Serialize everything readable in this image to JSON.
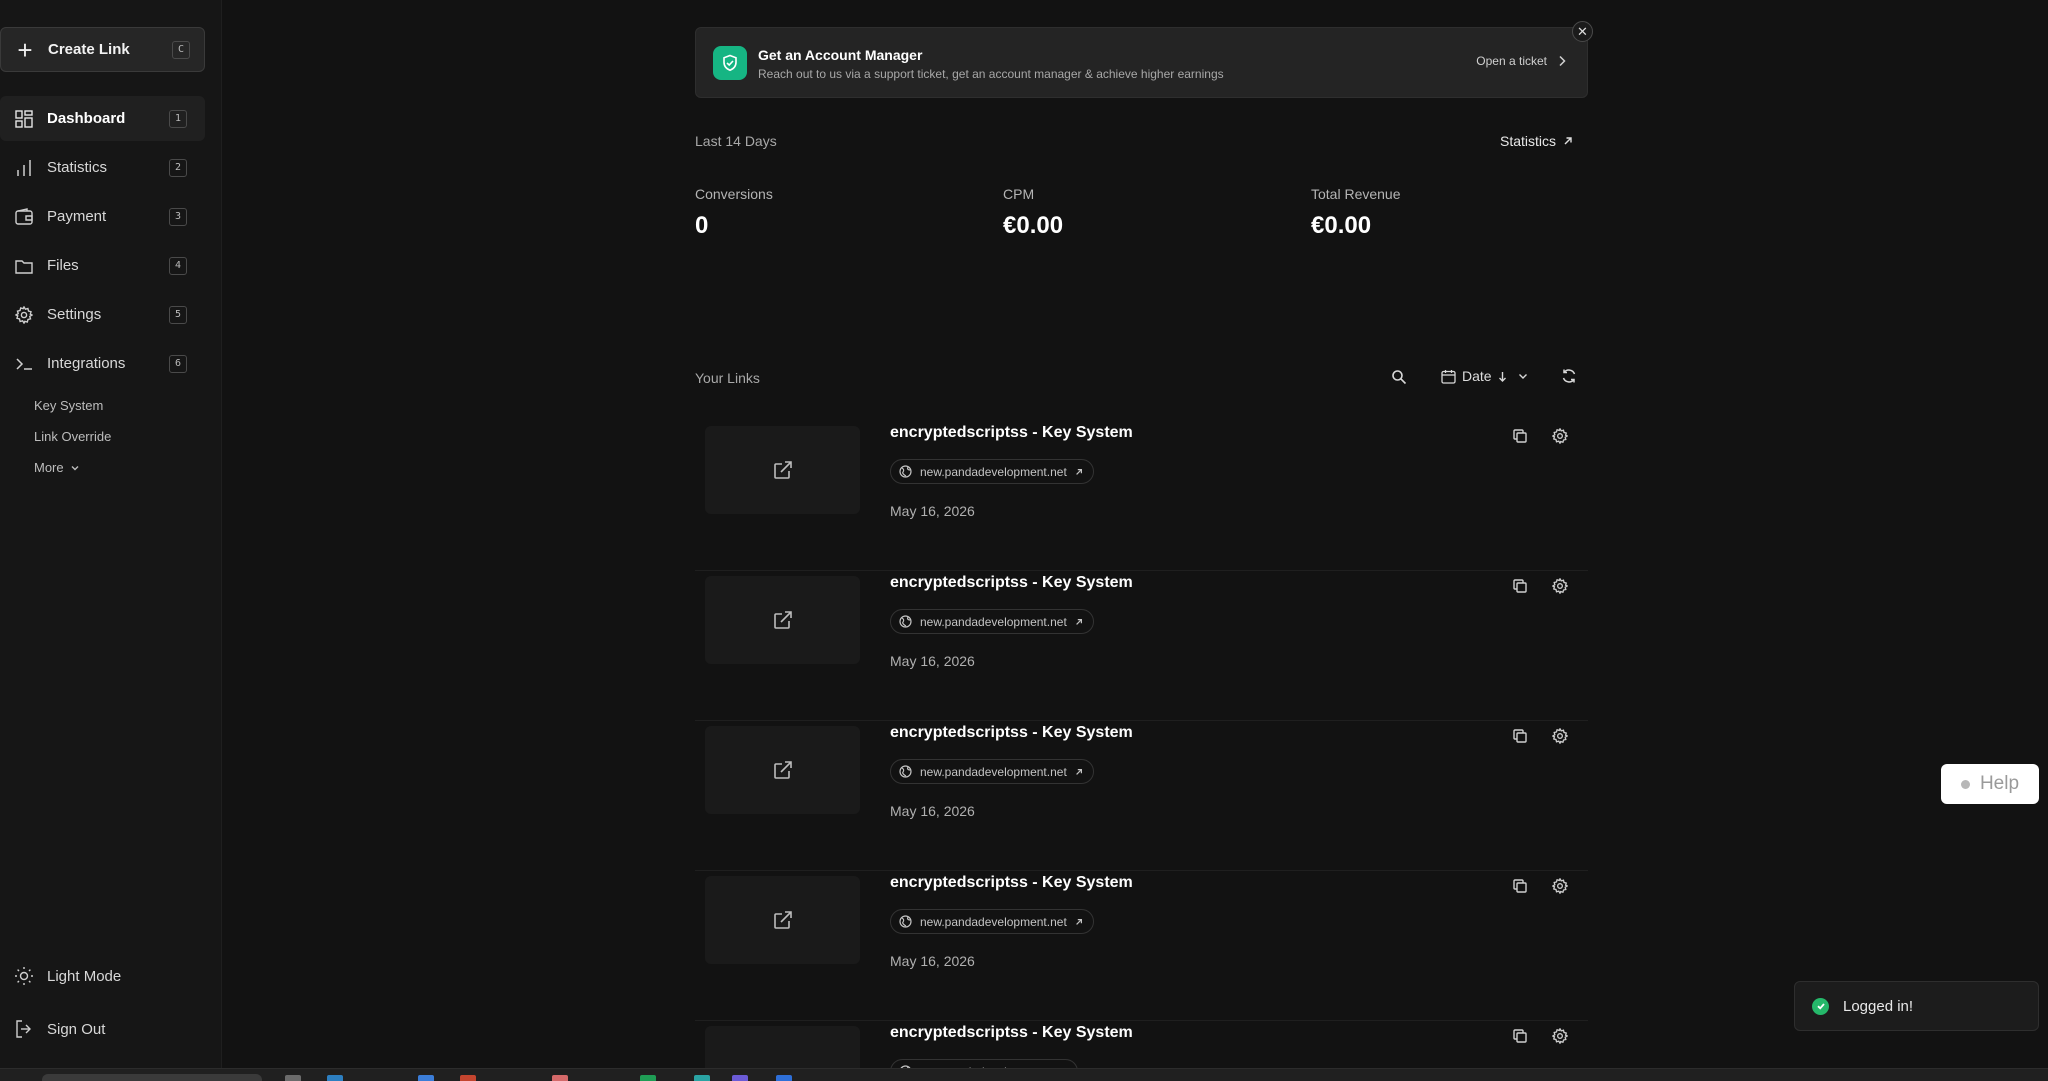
{
  "sidebar": {
    "create": {
      "label": "Create Link",
      "shortcut": "C"
    },
    "nav": [
      {
        "label": "Dashboard",
        "key": "1",
        "icon": "dashboard-icon",
        "active": true
      },
      {
        "label": "Statistics",
        "key": "2",
        "icon": "bar-chart-icon"
      },
      {
        "label": "Payment",
        "key": "3",
        "icon": "wallet-icon"
      },
      {
        "label": "Files",
        "key": "4",
        "icon": "folder-icon"
      },
      {
        "label": "Settings",
        "key": "5",
        "icon": "gear-icon"
      },
      {
        "label": "Integrations",
        "key": "6",
        "icon": "terminal-icon"
      }
    ],
    "sub_items": [
      "Key System",
      "Link Override"
    ],
    "more_label": "More",
    "light_mode": "Light Mode",
    "sign_out": "Sign Out"
  },
  "banner": {
    "title": "Get an Account Manager",
    "description": "Reach out to us via a support ticket, get an account manager & achieve higher earnings",
    "cta": "Open a ticket",
    "accent": "#16b583"
  },
  "overview": {
    "period": "Last 14 Days",
    "statistics_link": "Statistics",
    "metrics": [
      {
        "label": "Conversions",
        "value": "0"
      },
      {
        "label": "CPM",
        "value": "€0.00"
      },
      {
        "label": "Total Revenue",
        "value": "€0.00"
      }
    ]
  },
  "links_section": {
    "title": "Your Links",
    "sort_label": "Date",
    "items": [
      {
        "name": "encryptedscriptss - Key System",
        "domain": "new.pandadevelopment.net",
        "date": "May 16, 2026"
      },
      {
        "name": "encryptedscriptss - Key System",
        "domain": "new.pandadevelopment.net",
        "date": "May 16, 2026"
      },
      {
        "name": "encryptedscriptss - Key System",
        "domain": "new.pandadevelopment.net",
        "date": "May 16, 2026"
      },
      {
        "name": "encryptedscriptss - Key System",
        "domain": "new.pandadevelopment.net",
        "date": "May 16, 2026"
      },
      {
        "name": "encryptedscriptss - Key System",
        "domain": "new.pandadevelopment.net",
        "date": ""
      }
    ]
  },
  "help": {
    "label": "Help"
  },
  "toast": {
    "message": "Logged in!",
    "color": "#25b86a"
  }
}
